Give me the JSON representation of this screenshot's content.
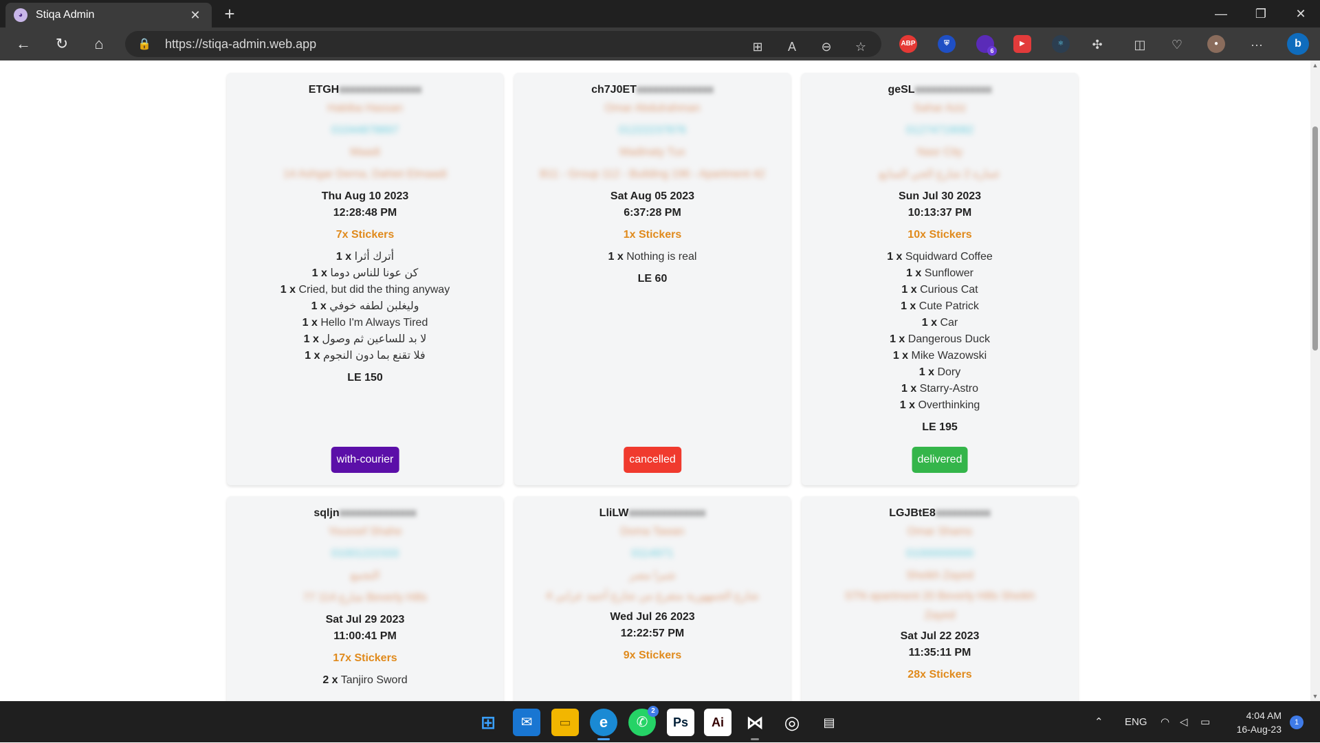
{
  "browser": {
    "tab_title": "Stiqa Admin",
    "url": "https://stiqa-admin.web.app",
    "ext_abp_label": "ABP",
    "ext_badge_count": "6"
  },
  "orders": [
    {
      "id_visible": "ETGH",
      "id_blurred": "xxxxxxxxxxxxxxx",
      "name_blurred": "Habiba Hassan",
      "phone_blurred": "01044878897",
      "city_blurred": "Maadi",
      "address_blurred": "14 Ashgar Derna, Dahiet Elmaadi",
      "date": "Thu Aug 10 2023",
      "time": "12:28:48 PM",
      "count_label": "7x Stickers",
      "items": [
        {
          "qty": "1 x",
          "name": "أترك أثرا"
        },
        {
          "qty": "1 x",
          "name": "كن عونا للناس دوما"
        },
        {
          "qty": "1 x",
          "name": "Cried, but did the thing anyway"
        },
        {
          "qty": "1 x",
          "name": "وليغلبن لطفه خوفي"
        },
        {
          "qty": "1 x",
          "name": "Hello I'm Always Tired"
        },
        {
          "qty": "1 x",
          "name": "لا بد للساعين ثم وصول"
        },
        {
          "qty": "1 x",
          "name": "فلا تقنع بما دون النجوم"
        }
      ],
      "total": "LE 150",
      "status": "with-courier",
      "status_color": "#5b0fa8"
    },
    {
      "id_visible": "ch7J0ET",
      "id_blurred": "xxxxxxxxxxxxxx",
      "name_blurred": "Omar Abdulrahman",
      "phone_blurred": "01222237876",
      "city_blurred": "Madinaty Tux",
      "address_blurred": "B11 - Group 112 - Building 196 - Apartment 42",
      "date": "Sat Aug 05 2023",
      "time": "6:37:28 PM",
      "count_label": "1x Stickers",
      "items": [
        {
          "qty": "1 x",
          "name": "Nothing is real"
        }
      ],
      "total": "LE 60",
      "status": "cancelled",
      "status_color": "#f03a2e"
    },
    {
      "id_visible": "geSL",
      "id_blurred": "xxxxxxxxxxxxxx",
      "name_blurred": "Sahar Aziz",
      "phone_blurred": "01274719082",
      "city_blurred": "Nasr City",
      "address_blurred": "عمارة 2 شارع الحي السابع",
      "date": "Sun Jul 30 2023",
      "time": "10:13:37 PM",
      "count_label": "10x Stickers",
      "items": [
        {
          "qty": "1 x",
          "name": "Squidward Coffee"
        },
        {
          "qty": "1 x",
          "name": "Sunflower"
        },
        {
          "qty": "1 x",
          "name": "Curious Cat"
        },
        {
          "qty": "1 x",
          "name": "Cute Patrick"
        },
        {
          "qty": "1 x",
          "name": "Car"
        },
        {
          "qty": "1 x",
          "name": "Dangerous Duck"
        },
        {
          "qty": "1 x",
          "name": "Mike Wazowski"
        },
        {
          "qty": "1 x",
          "name": "Dory"
        },
        {
          "qty": "1 x",
          "name": "Starry-Astro"
        },
        {
          "qty": "1 x",
          "name": "Overthinking"
        }
      ],
      "total": "LE 195",
      "status": "delivered",
      "status_color": "#34b54a"
    },
    {
      "id_visible": "sqljn",
      "id_blurred": "xxxxxxxxxxxxxx",
      "name_blurred": "Youssef Shahe",
      "phone_blurred": "01001222333",
      "city_blurred": "التجمع",
      "address_blurred": "77 شارع 114 Beverly Hills",
      "date": "Sat Jul 29 2023",
      "time": "11:00:41 PM",
      "count_label": "17x Stickers",
      "items": [
        {
          "qty": "2 x",
          "name": "Tanjiro Sword"
        }
      ]
    },
    {
      "id_visible": "LliLW",
      "id_blurred": "xxxxxxxxxxxxxx",
      "name_blurred": "Doma Tawan",
      "phone_blurred": "0114971",
      "city_blurred": "شبرا مصر",
      "address_blurred": "4 شارع الجمهورية متفرع من شارع أحمد عرابي",
      "date": "Wed Jul 26 2023",
      "time": "12:22:57 PM",
      "count_label": "9x Stickers",
      "items": []
    },
    {
      "id_visible": "LGJBtE8",
      "id_blurred": "xxxxxxxxxx",
      "name_blurred": "Omar Shams",
      "phone_blurred": "01000000000",
      "city_blurred": "Sheikh Zayed",
      "address_blurred": "STN apartment 20 Beverly Hills Sheikh Zayed",
      "date": "Sat Jul 22 2023",
      "time": "11:35:11 PM",
      "count_label": "28x Stickers",
      "items": []
    }
  ],
  "taskbar": {
    "whatsapp_badge": "2",
    "lang": "ENG",
    "time": "4:04 AM",
    "date": "16-Aug-23",
    "notif_count": "1"
  },
  "colors": {
    "accent_orange": "#e08a1c",
    "blur_cyan": "#6fd0e0",
    "card_bg": "#f4f5f6"
  }
}
